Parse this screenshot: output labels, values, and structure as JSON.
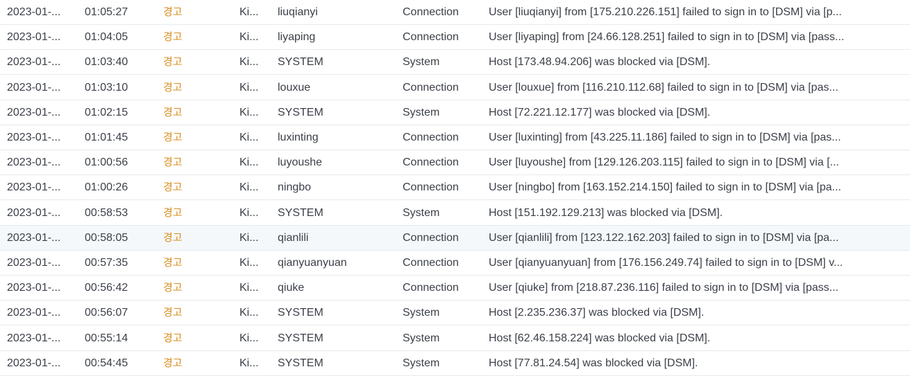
{
  "colors": {
    "level_warning": "#d98b1c",
    "text": "#3a3f47",
    "row_border": "#e6e9ee",
    "highlight_row": "#f5f8fb"
  },
  "highlighted_row_index": 9,
  "rows": [
    {
      "date": "2023-01-...",
      "time": "01:05:27",
      "level": "경고",
      "source": "Ki...",
      "user": "liuqianyi",
      "category": "Connection",
      "event": "User [liuqianyi] from [175.210.226.151] failed to sign in to [DSM] via [p..."
    },
    {
      "date": "2023-01-...",
      "time": "01:04:05",
      "level": "경고",
      "source": "Ki...",
      "user": "liyaping",
      "category": "Connection",
      "event": "User [liyaping] from [24.66.128.251] failed to sign in to [DSM] via [pass..."
    },
    {
      "date": "2023-01-...",
      "time": "01:03:40",
      "level": "경고",
      "source": "Ki...",
      "user": "SYSTEM",
      "category": "System",
      "event": "Host [173.48.94.206] was blocked via [DSM]."
    },
    {
      "date": "2023-01-...",
      "time": "01:03:10",
      "level": "경고",
      "source": "Ki...",
      "user": "louxue",
      "category": "Connection",
      "event": "User [louxue] from [116.210.112.68] failed to sign in to [DSM] via [pas..."
    },
    {
      "date": "2023-01-...",
      "time": "01:02:15",
      "level": "경고",
      "source": "Ki...",
      "user": "SYSTEM",
      "category": "System",
      "event": "Host [72.221.12.177] was blocked via [DSM]."
    },
    {
      "date": "2023-01-...",
      "time": "01:01:45",
      "level": "경고",
      "source": "Ki...",
      "user": "luxinting",
      "category": "Connection",
      "event": "User [luxinting] from [43.225.11.186] failed to sign in to [DSM] via [pas..."
    },
    {
      "date": "2023-01-...",
      "time": "01:00:56",
      "level": "경고",
      "source": "Ki...",
      "user": "luyoushe",
      "category": "Connection",
      "event": "User [luyoushe] from [129.126.203.115] failed to sign in to [DSM] via [..."
    },
    {
      "date": "2023-01-...",
      "time": "01:00:26",
      "level": "경고",
      "source": "Ki...",
      "user": "ningbo",
      "category": "Connection",
      "event": "User [ningbo] from [163.152.214.150] failed to sign in to [DSM] via [pa..."
    },
    {
      "date": "2023-01-...",
      "time": "00:58:53",
      "level": "경고",
      "source": "Ki...",
      "user": "SYSTEM",
      "category": "System",
      "event": "Host [151.192.129.213] was blocked via [DSM]."
    },
    {
      "date": "2023-01-...",
      "time": "00:58:05",
      "level": "경고",
      "source": "Ki...",
      "user": "qianlili",
      "category": "Connection",
      "event": "User [qianlili] from [123.122.162.203] failed to sign in to [DSM] via [pa..."
    },
    {
      "date": "2023-01-...",
      "time": "00:57:35",
      "level": "경고",
      "source": "Ki...",
      "user": "qianyuanyuan",
      "category": "Connection",
      "event": "User [qianyuanyuan] from [176.156.249.74] failed to sign in to [DSM] v..."
    },
    {
      "date": "2023-01-...",
      "time": "00:56:42",
      "level": "경고",
      "source": "Ki...",
      "user": "qiuke",
      "category": "Connection",
      "event": "User [qiuke] from [218.87.236.116] failed to sign in to [DSM] via [pass..."
    },
    {
      "date": "2023-01-...",
      "time": "00:56:07",
      "level": "경고",
      "source": "Ki...",
      "user": "SYSTEM",
      "category": "System",
      "event": "Host [2.235.236.37] was blocked via [DSM]."
    },
    {
      "date": "2023-01-...",
      "time": "00:55:14",
      "level": "경고",
      "source": "Ki...",
      "user": "SYSTEM",
      "category": "System",
      "event": "Host [62.46.158.224] was blocked via [DSM]."
    },
    {
      "date": "2023-01-...",
      "time": "00:54:45",
      "level": "경고",
      "source": "Ki...",
      "user": "SYSTEM",
      "category": "System",
      "event": "Host [77.81.24.54] was blocked via [DSM]."
    }
  ]
}
